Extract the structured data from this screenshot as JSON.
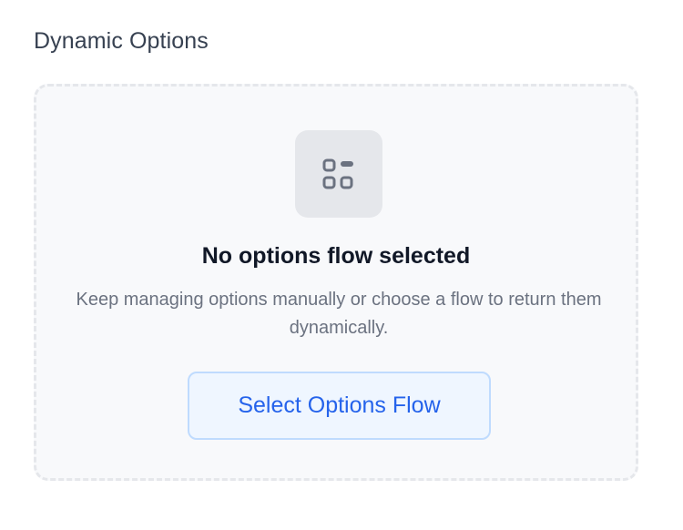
{
  "section": {
    "title": "Dynamic Options"
  },
  "empty_state": {
    "icon": "layout-grid-icon",
    "title": "No options flow selected",
    "description": "Keep managing options manually or choose a flow to return them dynamically.",
    "button_label": "Select Options Flow"
  },
  "colors": {
    "accent": "#2563eb",
    "button_bg": "#eff6ff",
    "button_border": "#bfdbfe",
    "panel_bg": "#f8f9fb",
    "panel_border": "#e5e7eb"
  }
}
